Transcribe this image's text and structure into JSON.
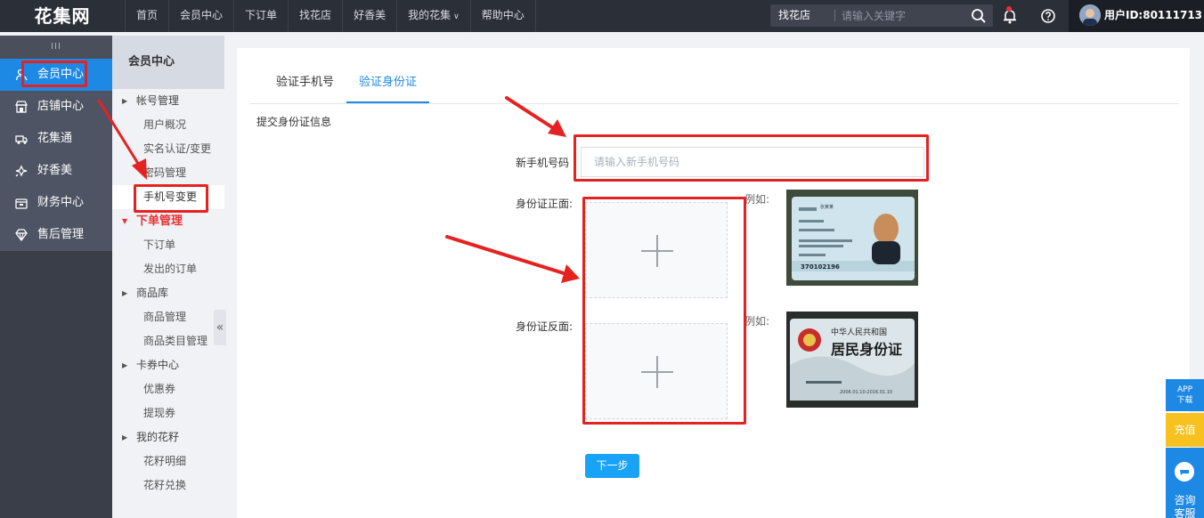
{
  "brand": "花集网",
  "nav": [
    "首页",
    "会员中心",
    "下订单",
    "找花店",
    "好香美",
    "我的花集",
    "帮助中心"
  ],
  "search": {
    "type_label": "找花店",
    "placeholder": "请输入关键字"
  },
  "user": {
    "id_label": "用户ID:80111713"
  },
  "sidebar": {
    "handle": "III",
    "items": [
      {
        "label": "会员中心",
        "icon": "user-icon"
      },
      {
        "label": "店铺中心",
        "icon": "shop-icon"
      },
      {
        "label": "花集通",
        "icon": "truck-icon"
      },
      {
        "label": "好香美",
        "icon": "flower-icon"
      },
      {
        "label": "财务中心",
        "icon": "wallet-icon"
      },
      {
        "label": "售后管理",
        "icon": "diamond-icon"
      }
    ]
  },
  "submenu": {
    "title": "会员中心",
    "groups": [
      {
        "label": "帐号管理",
        "links": [
          "用户概况",
          "实名认证/变更",
          "密码管理",
          "手机号变更"
        ]
      },
      {
        "label": "下单管理",
        "links": [
          "下订单",
          "发出的订单"
        ]
      },
      {
        "label": "商品库",
        "links": [
          "商品管理",
          "商品类目管理"
        ]
      },
      {
        "label": "卡券中心",
        "links": [
          "优惠券",
          "提现券"
        ]
      },
      {
        "label": "我的花籽",
        "links": [
          "花籽明细",
          "花籽兑换"
        ]
      }
    ],
    "collapse": "«"
  },
  "main": {
    "tabs": [
      "验证手机号",
      "验证身份证"
    ],
    "section_title": "提交身份证信息",
    "phone_label": "新手机号码",
    "phone_placeholder": "请输入新手机号码",
    "id_front_label": "身份证正面:",
    "id_back_label": "身份证反面:",
    "example_label": "例如:",
    "next_button": "下一步",
    "id_front_example": {
      "name": "张某某",
      "number": "370102196"
    },
    "id_back_example": {
      "country": "中华人民共和国",
      "title": "居民身份证",
      "validity": "2006.01.10-2016.01.10"
    }
  },
  "float": {
    "app": "APP下载",
    "app_line1": "APP",
    "app_line2": "下载",
    "charge": "充值",
    "service_line1": "咨询",
    "service_line2": "客服"
  },
  "colors": {
    "accent": "#1e88e5",
    "annotation": "#e52222",
    "topbar": "#2b2f38"
  }
}
